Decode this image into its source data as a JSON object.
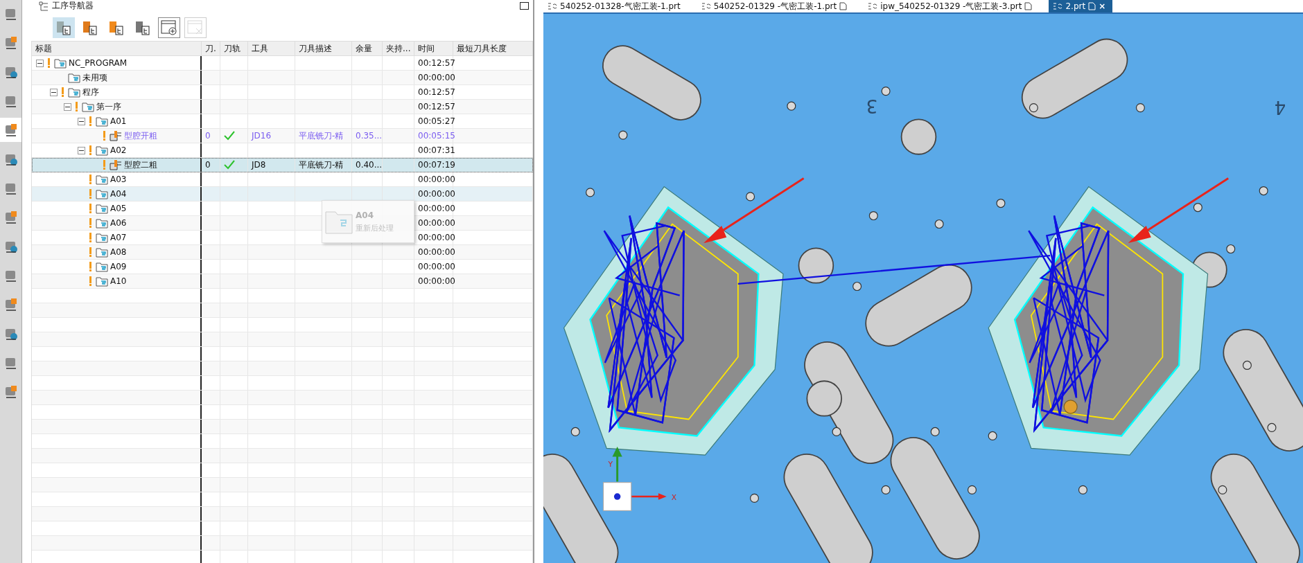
{
  "navigator": {
    "title": "工序导航器",
    "toolbar": [
      {
        "selected": true
      },
      {
        "selected": false
      },
      {
        "selected": false
      },
      {
        "selected": false
      },
      {
        "selected": false
      },
      {
        "selected": false,
        "disabled": true
      }
    ],
    "columns": [
      "标题",
      "刀.",
      "刀轨",
      "工具",
      "刀具描述",
      "余量",
      "夹持...",
      "时间",
      "最短刀具长度"
    ],
    "tree": [
      {
        "name": "NC_PROGRAM",
        "kind": "group",
        "warning": true,
        "expanded": true,
        "time": "00:12:57",
        "children": [
          {
            "name": "未用项",
            "kind": "group",
            "warning": false,
            "time": "00:00:00"
          },
          {
            "name": "程序",
            "kind": "group",
            "warning": true,
            "expanded": true,
            "time": "00:12:57",
            "children": [
              {
                "name": "第一序",
                "kind": "group",
                "warning": true,
                "expanded": true,
                "time": "00:12:57",
                "children": [
                  {
                    "name": "A01",
                    "kind": "group",
                    "warning": true,
                    "expanded": true,
                    "time": "00:05:27",
                    "children": [
                      {
                        "name": "型腔开粗",
                        "kind": "operation",
                        "warning": true,
                        "active": true,
                        "selected": false,
                        "count": "0",
                        "path_ok": true,
                        "tool": "JD16",
                        "tool_desc": "平底铣刀-精",
                        "stock": "0.35...",
                        "time": "00:05:15"
                      }
                    ]
                  },
                  {
                    "name": "A02",
                    "kind": "group",
                    "warning": true,
                    "expanded": true,
                    "time": "00:07:31",
                    "children": [
                      {
                        "name": "型腔二粗",
                        "kind": "operation",
                        "warning": true,
                        "active": false,
                        "selected": true,
                        "count": "0",
                        "path_ok": true,
                        "tool": "JD8",
                        "tool_desc": "平底铣刀-精",
                        "stock": "0.40...",
                        "time": "00:07:19"
                      }
                    ]
                  },
                  {
                    "name": "A03",
                    "kind": "group",
                    "warning": true,
                    "time": "00:00:00"
                  },
                  {
                    "name": "A04",
                    "kind": "group",
                    "warning": true,
                    "hovered": true,
                    "time": "00:00:00"
                  },
                  {
                    "name": "A05",
                    "kind": "group",
                    "warning": true,
                    "time": "00:00:00"
                  },
                  {
                    "name": "A06",
                    "kind": "group",
                    "warning": true,
                    "time": "00:00:00"
                  },
                  {
                    "name": "A07",
                    "kind": "group",
                    "warning": true,
                    "time": "00:00:00"
                  },
                  {
                    "name": "A08",
                    "kind": "group",
                    "warning": true,
                    "time": "00:00:00"
                  },
                  {
                    "name": "A09",
                    "kind": "group",
                    "warning": true,
                    "time": "00:00:00"
                  },
                  {
                    "name": "A10",
                    "kind": "group",
                    "warning": true,
                    "time": "00:00:00"
                  }
                ]
              }
            ]
          }
        ]
      }
    ],
    "drag_ghost": {
      "title": "A04",
      "subtitle": "重新后处理"
    }
  },
  "left_strip": [
    {
      "selected": false
    },
    {
      "selected": false
    },
    {
      "selected": false
    },
    {
      "selected": false
    },
    {
      "selected": true
    },
    {
      "selected": false
    },
    {
      "selected": false
    },
    {
      "selected": false
    },
    {
      "selected": false
    },
    {
      "selected": false
    },
    {
      "selected": false
    },
    {
      "selected": false
    },
    {
      "selected": false
    },
    {
      "selected": false
    }
  ],
  "tabs": [
    {
      "label": "540252-01328-气密工装-1.prt",
      "selected": false,
      "file_icon": false
    },
    {
      "label": "540252-01329 -气密工装-1.prt",
      "selected": false,
      "file_icon": true
    },
    {
      "label": "ipw_540252-01329 -气密工装-3.prt",
      "selected": false,
      "file_icon": true
    },
    {
      "label": "2.prt",
      "selected": true,
      "file_icon": true,
      "close": "×"
    }
  ],
  "viewport": {
    "part_labels": [
      "3",
      "4"
    ],
    "axis_labels": [
      "X",
      "Y"
    ]
  }
}
